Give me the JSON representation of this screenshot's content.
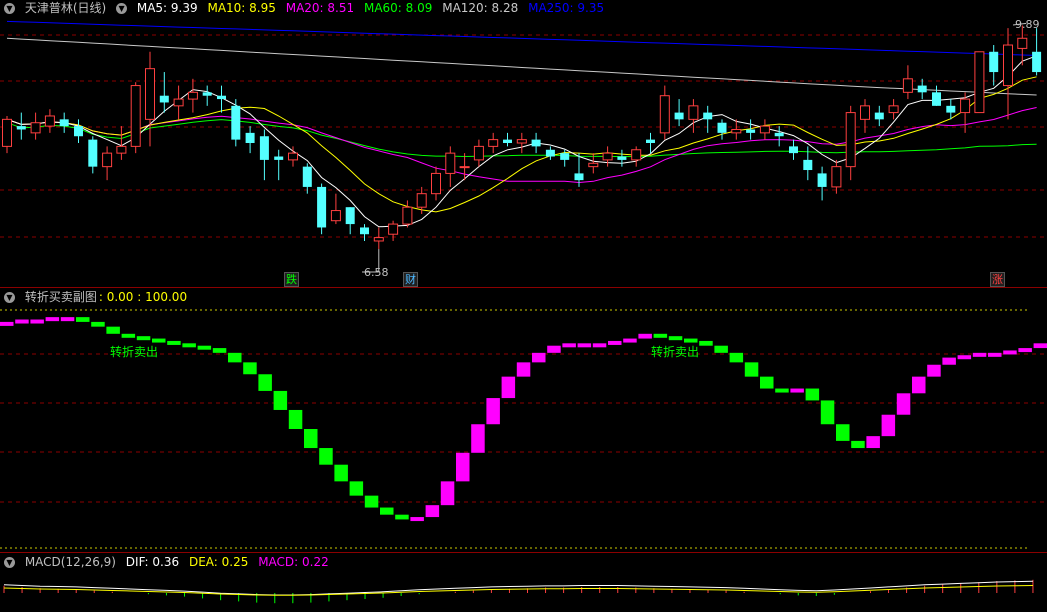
{
  "header": {
    "title": "天津普林(日线)",
    "ma": [
      {
        "label": "MA5: 9.39",
        "color": "#ffffff"
      },
      {
        "label": "MA10: 8.95",
        "color": "#ffff00"
      },
      {
        "label": "MA20: 8.51",
        "color": "#ff00ff"
      },
      {
        "label": "MA60: 8.09",
        "color": "#00ff00"
      },
      {
        "label": "MA120: 8.28",
        "color": "#c8c8c8"
      },
      {
        "label": "MA250: 9.35",
        "color": "#0000ff"
      }
    ]
  },
  "price_annotations": {
    "high": "9.89",
    "low": "6.58"
  },
  "markers": [
    {
      "text": "跌",
      "color": "#00ff00"
    },
    {
      "text": "财",
      "color": "#4db8ff"
    },
    {
      "text": "涨",
      "color": "#ff4040"
    }
  ],
  "indicator": {
    "name": "转折买卖副图",
    "values": ": 0.00 : 100.00",
    "signals": [
      "转折卖出",
      "转折卖出"
    ]
  },
  "macd_header": {
    "name": "MACD(12,26,9)",
    "dif": "DIF: 0.36",
    "dea": "DEA: 0.25",
    "macd": "MACD: 0.22"
  },
  "colors": {
    "up": "#ff4040",
    "down": "#54ffff",
    "bull": "#ff00ff",
    "bear": "#00ff00",
    "grid": "#8b0000"
  },
  "chart_data": [
    {
      "type": "candlestick",
      "ylim": [
        6.3,
        10.0
      ],
      "candles": [
        [
          8.1,
          8.5,
          8.55,
          8.0
        ],
        [
          8.4,
          8.35,
          8.6,
          8.2
        ],
        [
          8.3,
          8.45,
          8.6,
          8.2
        ],
        [
          8.4,
          8.55,
          8.65,
          8.3
        ],
        [
          8.5,
          8.4,
          8.6,
          8.3
        ],
        [
          8.4,
          8.25,
          8.5,
          8.15
        ],
        [
          8.2,
          7.8,
          8.25,
          7.7
        ],
        [
          7.8,
          8.0,
          8.1,
          7.6
        ],
        [
          8.0,
          8.1,
          8.4,
          7.9
        ],
        [
          8.1,
          9.0,
          9.05,
          8.0
        ],
        [
          8.5,
          9.25,
          9.5,
          8.1
        ],
        [
          8.85,
          8.75,
          9.2,
          8.6
        ],
        [
          8.7,
          8.8,
          9.0,
          8.5
        ],
        [
          8.8,
          8.9,
          9.1,
          8.6
        ],
        [
          8.9,
          8.85,
          9.0,
          8.7
        ],
        [
          8.85,
          8.8,
          9.0,
          8.6
        ],
        [
          8.7,
          8.2,
          8.8,
          8.1
        ],
        [
          8.3,
          8.15,
          8.4,
          8.0
        ],
        [
          8.25,
          7.9,
          8.35,
          7.6
        ],
        [
          7.95,
          7.9,
          8.05,
          7.6
        ],
        [
          7.9,
          8.0,
          8.1,
          7.8
        ],
        [
          7.8,
          7.5,
          7.85,
          7.4
        ],
        [
          7.5,
          6.9,
          7.55,
          6.8
        ],
        [
          7.0,
          7.15,
          7.4,
          6.95
        ],
        [
          7.2,
          6.95,
          7.2,
          6.8
        ],
        [
          6.9,
          6.8,
          6.95,
          6.7
        ],
        [
          6.7,
          6.75,
          6.9,
          6.58
        ],
        [
          6.8,
          6.95,
          7.0,
          6.7
        ],
        [
          6.95,
          7.2,
          7.3,
          6.9
        ],
        [
          7.2,
          7.4,
          7.5,
          7.1
        ],
        [
          7.4,
          7.7,
          7.8,
          7.3
        ],
        [
          7.7,
          8.0,
          8.1,
          7.5
        ],
        [
          7.8,
          7.8,
          8.0,
          7.6
        ],
        [
          7.9,
          8.1,
          8.2,
          7.8
        ],
        [
          8.1,
          8.2,
          8.3,
          8.0
        ],
        [
          8.2,
          8.15,
          8.3,
          8.1
        ],
        [
          8.15,
          8.2,
          8.3,
          8.0
        ],
        [
          8.2,
          8.1,
          8.3,
          8.0
        ],
        [
          8.05,
          7.95,
          8.1,
          7.9
        ],
        [
          8.0,
          7.9,
          8.05,
          7.8
        ],
        [
          7.7,
          7.6,
          8.0,
          7.5
        ],
        [
          7.8,
          7.85,
          8.0,
          7.7
        ],
        [
          7.9,
          8.0,
          8.1,
          7.8
        ],
        [
          7.95,
          7.9,
          8.05,
          7.8
        ],
        [
          7.9,
          8.05,
          8.1,
          7.8
        ],
        [
          8.2,
          8.15,
          8.3,
          8.0
        ],
        [
          8.3,
          8.85,
          9.0,
          8.2
        ],
        [
          8.6,
          8.5,
          8.8,
          8.4
        ],
        [
          8.5,
          8.7,
          8.8,
          8.3
        ],
        [
          8.6,
          8.5,
          8.7,
          8.3
        ],
        [
          8.45,
          8.3,
          8.5,
          8.2
        ],
        [
          8.3,
          8.35,
          8.5,
          8.2
        ],
        [
          8.35,
          8.3,
          8.5,
          8.2
        ],
        [
          8.3,
          8.4,
          8.5,
          8.2
        ],
        [
          8.3,
          8.25,
          8.4,
          8.1
        ],
        [
          8.1,
          8.0,
          8.2,
          7.9
        ],
        [
          7.9,
          7.75,
          8.1,
          7.6
        ],
        [
          7.7,
          7.5,
          7.8,
          7.3
        ],
        [
          7.5,
          7.8,
          7.9,
          7.4
        ],
        [
          7.8,
          8.6,
          8.7,
          7.6
        ],
        [
          8.5,
          8.7,
          8.8,
          8.3
        ],
        [
          8.6,
          8.5,
          8.7,
          8.4
        ],
        [
          8.6,
          8.7,
          8.8,
          8.5
        ],
        [
          8.9,
          9.1,
          9.3,
          8.8
        ],
        [
          9.0,
          8.9,
          9.1,
          8.8
        ],
        [
          8.9,
          8.7,
          9.0,
          8.7
        ],
        [
          8.7,
          8.6,
          8.8,
          8.5
        ],
        [
          8.6,
          8.8,
          8.9,
          8.3
        ],
        [
          8.6,
          9.5,
          9.5,
          8.6
        ],
        [
          9.5,
          9.2,
          9.6,
          9.0
        ],
        [
          9.0,
          9.6,
          9.85,
          8.5
        ],
        [
          9.55,
          9.7,
          9.89,
          9.3
        ],
        [
          9.5,
          9.2,
          9.85,
          9.15
        ]
      ]
    },
    {
      "type": "bar",
      "ylim": [
        0,
        100
      ],
      "values": [
        95,
        96,
        96,
        97,
        97,
        95,
        93,
        90,
        89,
        88,
        87,
        86,
        85,
        84,
        82,
        78,
        73,
        66,
        58,
        50,
        42,
        35,
        28,
        22,
        17,
        14,
        12,
        13,
        18,
        28,
        40,
        52,
        63,
        72,
        78,
        82,
        85,
        86,
        86,
        86,
        87,
        88,
        90,
        89,
        88,
        87,
        85,
        82,
        78,
        72,
        67,
        66,
        67,
        62,
        52,
        45,
        42,
        47,
        56,
        65,
        72,
        77,
        80,
        81,
        82,
        82,
        83,
        84,
        86,
        88,
        89,
        90
      ]
    },
    {
      "type": "bar",
      "values": [
        0.12,
        0.1,
        0.08,
        0.07,
        0.06,
        0.04,
        0.02,
        0.0,
        -0.02,
        -0.04,
        -0.06,
        -0.09,
        -0.12,
        -0.14,
        -0.16,
        -0.17,
        -0.17,
        -0.16,
        -0.14,
        -0.12,
        -0.1,
        -0.08,
        -0.05,
        -0.02,
        0.0,
        0.02,
        0.04,
        0.06,
        0.07,
        0.08,
        0.09,
        0.09,
        0.1,
        0.1,
        0.1,
        0.09,
        0.08,
        0.07,
        0.06,
        0.05,
        0.04,
        0.02,
        0.0,
        -0.02,
        -0.04,
        -0.05,
        -0.03,
        0.0,
        0.03,
        0.06,
        0.09,
        0.12,
        0.14,
        0.16,
        0.18,
        0.2,
        0.21,
        0.22
      ]
    }
  ]
}
